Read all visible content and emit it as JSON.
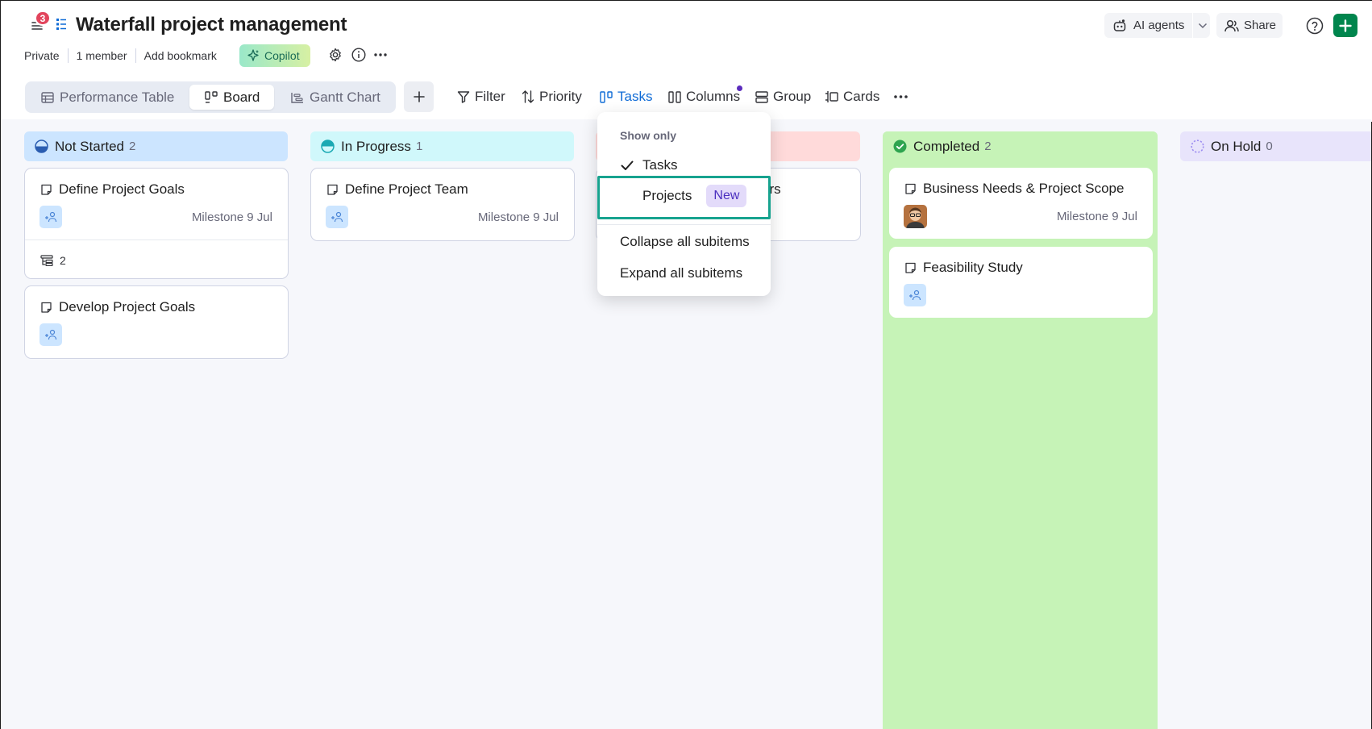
{
  "header": {
    "notification_count": "3",
    "title": "Waterfall project management",
    "ai_agents_label": "AI agents",
    "share_label": "Share",
    "meta": {
      "privacy": "Private",
      "members": "1 member",
      "bookmark": "Add bookmark",
      "copilot": "Copilot"
    }
  },
  "views": {
    "tabs": [
      {
        "label": "Performance Table",
        "icon": "table-icon"
      },
      {
        "label": "Board",
        "icon": "board-icon",
        "active": true
      },
      {
        "label": "Gantt Chart",
        "icon": "gantt-icon"
      }
    ]
  },
  "toolbar": {
    "filter": "Filter",
    "priority": "Priority",
    "tasks": "Tasks",
    "columns": "Columns",
    "group": "Group",
    "cards": "Cards"
  },
  "board": {
    "columns": [
      {
        "name": "Not Started",
        "count": "2",
        "color": "#cce5ff",
        "cards": [
          {
            "title": "Define Project Goals",
            "milestone": "Milestone 9 Jul",
            "subitems": "2"
          },
          {
            "title": "Develop Project Goals"
          }
        ]
      },
      {
        "name": "In Progress",
        "count": "1",
        "color": "#d0f8fb",
        "cards": [
          {
            "title": "Define Project Team",
            "milestone": "Milestone 9 Jul"
          }
        ]
      },
      {
        "name": "",
        "count": "",
        "color": "#ffdada",
        "cards": [
          {
            "title_fragment": "ers"
          }
        ]
      },
      {
        "name": "Completed",
        "count": "2",
        "color": "#c6f3b7",
        "cards": [
          {
            "title": "Business Needs & Project Scope",
            "milestone": "Milestone 9 Jul"
          },
          {
            "title": "Feasibility Study"
          }
        ]
      },
      {
        "name": "On Hold",
        "count": "0",
        "color": "#e8e4fb",
        "cards": []
      }
    ]
  },
  "dropdown": {
    "header": "Show only",
    "items": [
      {
        "label": "Tasks",
        "checked": true
      },
      {
        "label": "Projects",
        "badge": "New",
        "highlighted": true
      },
      {
        "label": "Collapse all subitems"
      },
      {
        "label": "Expand all subitems"
      }
    ]
  },
  "colors": {
    "accent_blue": "#0f6bd6",
    "primary_green": "#00854d",
    "highlight_teal": "#17a38f",
    "notification_red": "#e2445c"
  }
}
